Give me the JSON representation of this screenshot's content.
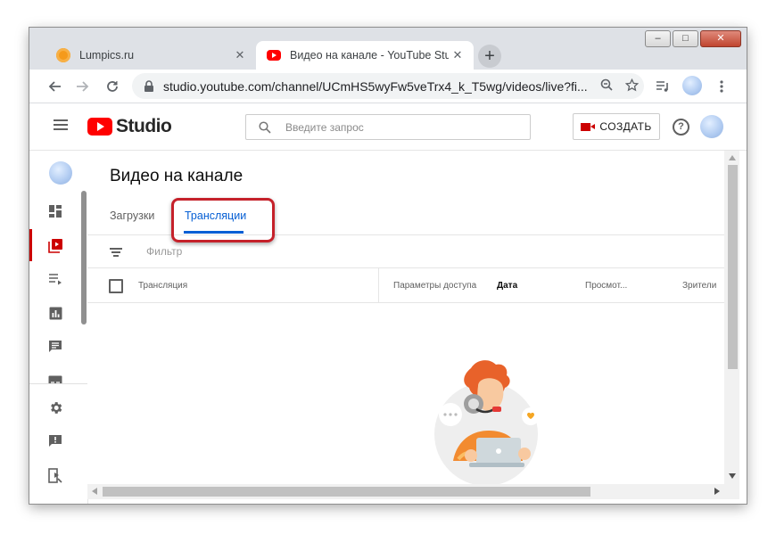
{
  "browser": {
    "tabs": [
      {
        "title": "Lumpics.ru",
        "favicon": "orange-circle-icon",
        "active": false
      },
      {
        "title": "Видео на канале - YouTube Studio",
        "favicon": "youtube-icon",
        "active": true
      }
    ],
    "tab_close": "✕",
    "new_tab": "+",
    "url": "studio.youtube.com/channel/UCmHS5wyFw5veTrx4_k_T5wg/videos/live?fi...",
    "window_controls": {
      "minimize": "–",
      "maximize": "□",
      "close": "✕"
    }
  },
  "studio": {
    "logo_text": "Studio",
    "search_placeholder": "Введите запрос",
    "create_label": "СОЗДАТЬ",
    "help_label": "?"
  },
  "sidebar": {
    "items": [
      {
        "icon": "dashboard-icon"
      },
      {
        "icon": "video-library-icon",
        "active": true
      },
      {
        "icon": "playlist-icon"
      },
      {
        "icon": "analytics-icon"
      },
      {
        "icon": "comments-icon"
      },
      {
        "icon": "subtitles-icon"
      },
      {
        "icon": "settings-icon"
      },
      {
        "icon": "feedback-icon"
      },
      {
        "icon": "creator-studio-classic-icon"
      }
    ]
  },
  "content": {
    "title": "Видео на канале",
    "tabs": [
      {
        "label": "Загрузки",
        "active": false
      },
      {
        "label": "Трансляции",
        "active": true
      }
    ],
    "filter_label": "Фильтр",
    "columns": [
      "Трансляция",
      "Параметры доступа",
      "Дата",
      "Просмот...",
      "Зрители"
    ],
    "sorted_column": "Дата"
  },
  "colors": {
    "accent_blue": "#065fd4",
    "brand_red": "#ff0000",
    "highlight_red": "#c5212a"
  }
}
